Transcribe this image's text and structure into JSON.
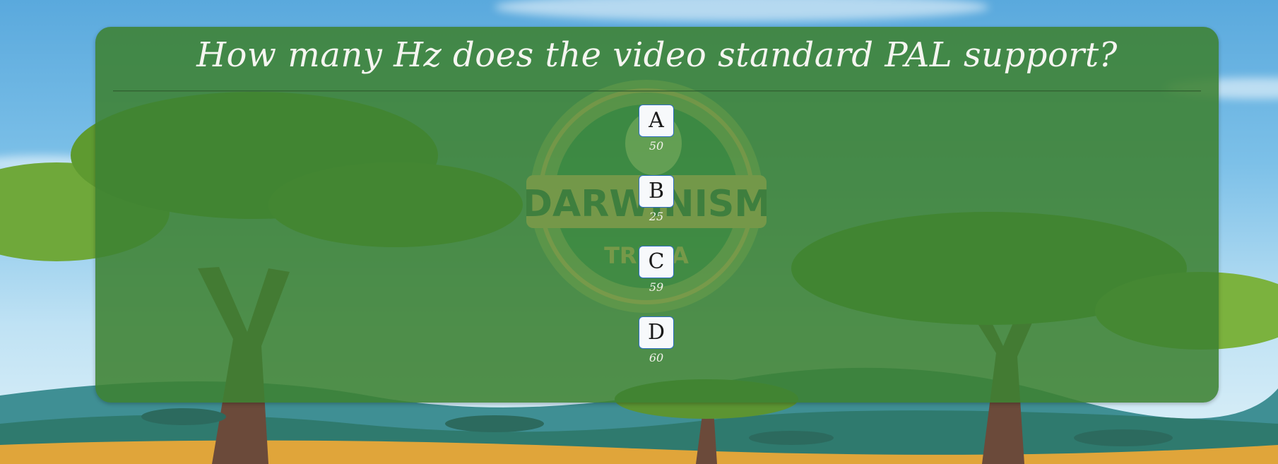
{
  "quiz": {
    "question": "How many Hz does the video standard PAL support?",
    "answers": [
      {
        "letter": "A",
        "value": "50"
      },
      {
        "letter": "B",
        "value": "25"
      },
      {
        "letter": "C",
        "value": "59"
      },
      {
        "letter": "D",
        "value": "60"
      }
    ]
  },
  "logo": {
    "title": "DARWINISM",
    "subtitle": "TRIVIA"
  },
  "colors": {
    "panel": "#3d8232",
    "sky": "#5aa9dd",
    "button_border": "#2f6fc4"
  }
}
